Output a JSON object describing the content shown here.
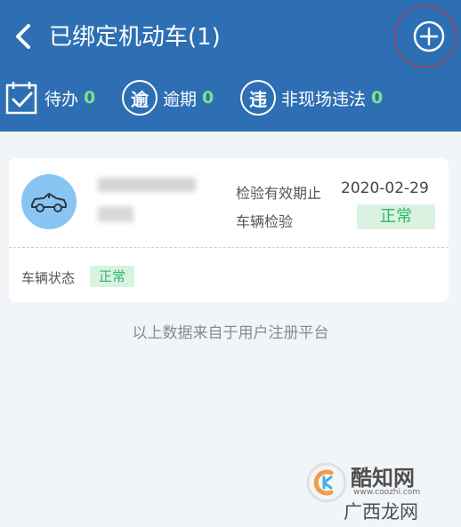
{
  "header": {
    "title": "已绑定机动车(1)",
    "color": "#2e6fb4"
  },
  "stats": [
    {
      "icon": "calendar-check-icon",
      "label": "待办",
      "count": "0"
    },
    {
      "icon_char": "逾",
      "label": "逾期",
      "count": "0"
    },
    {
      "icon_char": "违",
      "label": "非现场违法",
      "count": "0"
    }
  ],
  "card": {
    "validity_label": "检验有效期止",
    "validity_date": "2020-02-29",
    "inspection_label": "车辆检验",
    "inspection_status": "正常",
    "vehicle_status_label": "车辆状态",
    "vehicle_status": "正常"
  },
  "footer_note": "以上数据来自于用户注册平台",
  "watermark": {
    "name": "酷知网",
    "url": "www.coozhi.com",
    "sub": "广西龙网"
  },
  "colors": {
    "ok_text": "#2fb86a",
    "ok_bg": "#d9f2e1",
    "count_green": "#7fe08a",
    "annotation_red": "#e02a2a"
  }
}
